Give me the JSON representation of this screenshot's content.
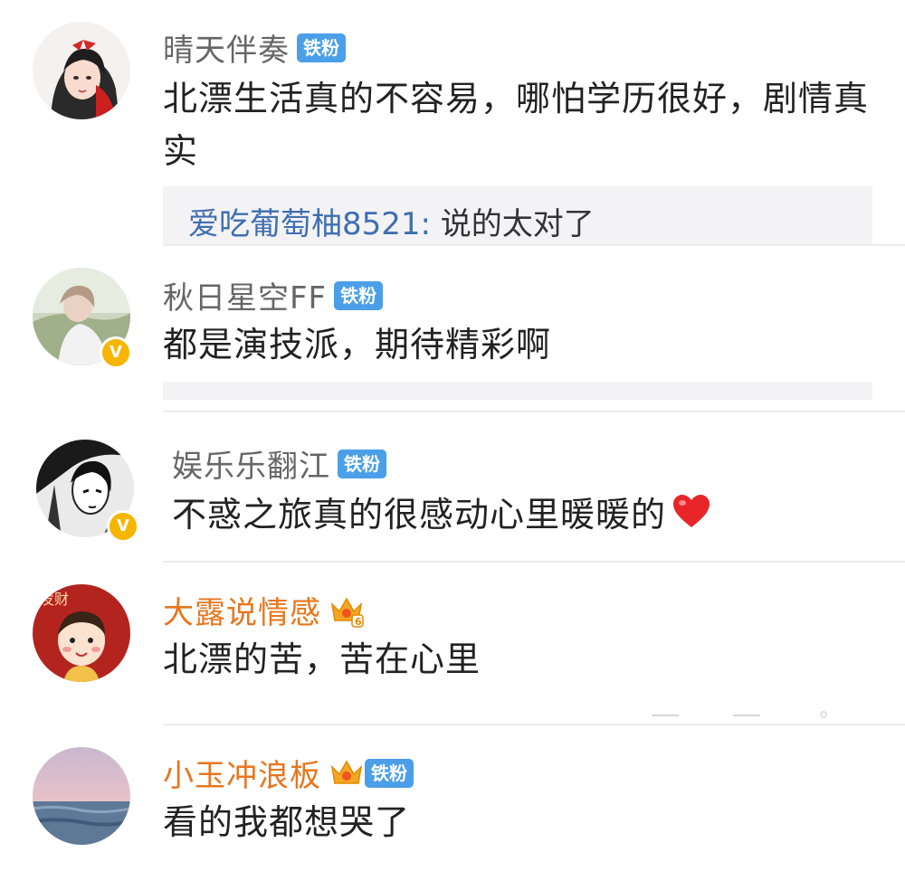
{
  "comments": [
    {
      "avatar": "avatar-girl-red-bow",
      "username": "晴天伴奏",
      "badge": "铁粉",
      "text": "北漂生活真的不容易，哪怕学历很好，剧情真实",
      "reply": {
        "user": "爱吃葡萄柚8521",
        "separator": ": ",
        "text": "说的太对了"
      }
    },
    {
      "avatar": "avatar-girl-outdoor",
      "username": "秋日星空FF",
      "badge": "铁粉",
      "verified": "V",
      "text": "都是演技派，期待精彩啊"
    },
    {
      "avatar": "avatar-manga-bw",
      "username": "娱乐乐翻江",
      "badge": "铁粉",
      "verified": "V",
      "text": "不惑之旅真的很感动心里暖暖的",
      "emoji": "heart-icon"
    },
    {
      "avatar": "avatar-cartoon-fortune",
      "avatar_text": "发财",
      "username": "大露说情感",
      "crown_level": "6",
      "text": "北漂的苦，苦在心里"
    },
    {
      "avatar": "avatar-sea-sunset",
      "username": "小玉冲浪板",
      "crown_level": "",
      "badge": "铁粉",
      "text": "看的我都想哭了"
    }
  ],
  "colors": {
    "username": "#666666",
    "username_vip": "#e8761e",
    "badge": "#4a9fe8",
    "reply_user": "#3f6fb0",
    "verified": "#f7b500",
    "content": "#222222"
  }
}
